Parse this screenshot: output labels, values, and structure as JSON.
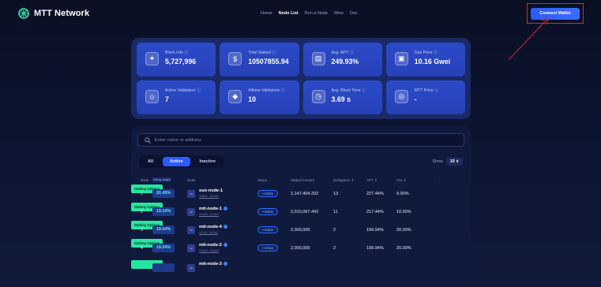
{
  "header": {
    "brand": "MTT Network",
    "nav": [
      "Home",
      "Node List",
      "Run a Node",
      "Mine",
      "Doc"
    ],
    "active_nav": "Node List",
    "connect_label": "Connect Wallet"
  },
  "stats": [
    {
      "label": "Block Info ⓘ",
      "value": "5,727,996",
      "icon": "cube-icon",
      "glyph": "✦"
    },
    {
      "label": "Total Staked ⓘ",
      "value": "10507855.94",
      "icon": "coin-icon",
      "glyph": "$"
    },
    {
      "label": "Avg. APY ⓘ",
      "value": "249.93%",
      "icon": "chart-icon",
      "glyph": "▤"
    },
    {
      "label": "Gas Price ⓘ",
      "value": "10.16 Gwei",
      "icon": "gas-icon",
      "glyph": "▣"
    },
    {
      "label": "Active Validators ⓘ",
      "value": "7",
      "icon": "user-icon",
      "glyph": "☺"
    },
    {
      "label": "Alltime Validators ⓘ",
      "value": "10",
      "icon": "diamond-icon",
      "glyph": "◆"
    },
    {
      "label": "Avg. Block Time ⓘ",
      "value": "3.69 s",
      "icon": "clock-icon",
      "glyph": "◷"
    },
    {
      "label": "MTT Price ⓘ",
      "value": "-",
      "icon": "price-icon",
      "glyph": "◎"
    }
  ],
  "search": {
    "placeholder": "Enter name or address"
  },
  "tabs": [
    "All",
    "Active",
    "Inactive"
  ],
  "active_tab": "Active",
  "show": {
    "label": "Show",
    "value": "10 ∨"
  },
  "columns": {
    "rank": "Rank",
    "voting": "Voting weight",
    "node": "Node",
    "status": "Status",
    "staked": "Staked Amount",
    "delegators": "Delegators ⇕",
    "apy": "APY ⇕",
    "fee": "Fee ⇕",
    "action": "-"
  },
  "rows": [
    {
      "rank": "1",
      "power": "20.45%",
      "name": "suo-node-1",
      "sub": "0x3b4c...5a4c9b",
      "verified": false,
      "status": "• Active",
      "staked": "2,147,404.292",
      "delegators": "13",
      "apy": "227.44%",
      "fee": "9.00%",
      "action": "Staking Options"
    },
    {
      "rank": "2",
      "power": "19.14%",
      "name": "mtt-node-1",
      "sub": "0x0d2b...3e46c1",
      "verified": true,
      "status": "• Active",
      "staked": "2,010,067.442",
      "delegators": "11",
      "apy": "217.44%",
      "fee": "10.00%",
      "action": "Staking Options"
    },
    {
      "rank": "3",
      "power": "19.04%",
      "name": "mtt-node-4",
      "sub": "0x7a2f...9c30e2",
      "verified": true,
      "status": "• Active",
      "staked": "2,000,000",
      "delegators": "2",
      "apy": "199.94%",
      "fee": "20.00%",
      "action": "Staking Options"
    },
    {
      "rank": "4",
      "power": "19.04%",
      "name": "mtt-node-2",
      "sub": "0x5e81...2d4aa7",
      "verified": true,
      "status": "• Active",
      "staked": "2,000,000",
      "delegators": "2",
      "apy": "199.94%",
      "fee": "20.00%",
      "action": "Staking Options"
    },
    {
      "rank": "",
      "power": "",
      "name": "mtt-node-3",
      "sub": "",
      "verified": true,
      "status": "",
      "staked": "",
      "delegators": "",
      "apy": "",
      "fee": "",
      "action": ""
    }
  ],
  "colors": {
    "accent": "#2e5bff",
    "success": "#27e5a0",
    "card": "#2c4ac7",
    "highlight": "#d8282c"
  }
}
